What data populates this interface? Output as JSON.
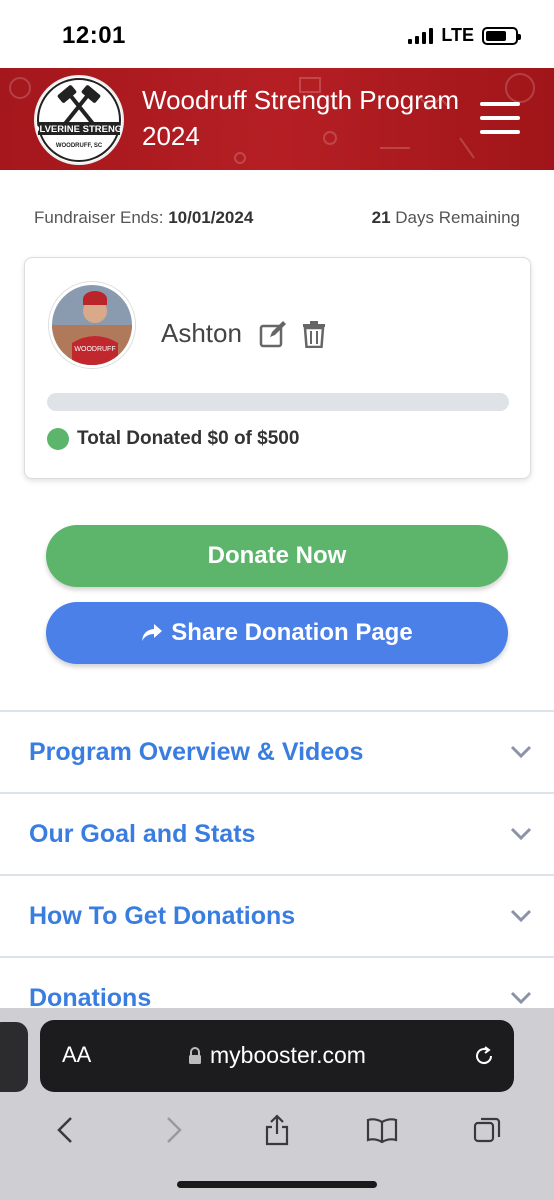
{
  "status_bar": {
    "time": "12:01",
    "network": "LTE"
  },
  "header": {
    "title_line1": "Woodruff Strength Program",
    "title_line2": "2024",
    "logo_text_main": "WOLVERINE STRENGTH",
    "logo_text_sub": "WOODRUFF, SC"
  },
  "fundraiser": {
    "ends_label": "Fundraiser Ends:",
    "ends_date": "10/01/2024",
    "days_count": "21",
    "days_label": "Days Remaining"
  },
  "participant": {
    "name": "Ashton",
    "donated_text": "Total Donated $0 of $500",
    "progress_fraction": 0
  },
  "buttons": {
    "donate": "Donate Now",
    "share": "Share Donation Page"
  },
  "accordion": [
    {
      "title": "Program Overview & Videos"
    },
    {
      "title": "Our Goal and Stats"
    },
    {
      "title": "How To Get Donations"
    },
    {
      "title": "Donations"
    }
  ],
  "browser": {
    "aa_label": "AA",
    "url": "mybooster.com"
  },
  "icons": [
    "menu-icon",
    "edit-icon",
    "trash-icon",
    "share-arrow-icon",
    "chevron-down-icon",
    "lock-icon",
    "reload-icon",
    "back-icon",
    "forward-icon",
    "share-icon",
    "bookmarks-icon",
    "tabs-icon"
  ],
  "colors": {
    "header_red": "#a4171c",
    "green": "#5cb56b",
    "blue": "#4a80e8",
    "link_blue": "#3a7de0"
  }
}
